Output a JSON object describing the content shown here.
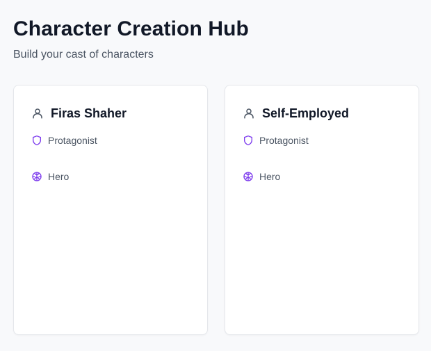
{
  "header": {
    "title": "Character Creation Hub",
    "subtitle": "Build your cast of characters"
  },
  "cards": [
    {
      "name": "Firas Shaher",
      "role": "Protagonist",
      "trait": "Hero",
      "icons": {
        "name": "user-icon",
        "role": "shield-icon",
        "trait": "brain-icon"
      }
    },
    {
      "name": "Self-Employed",
      "role": "Protagonist",
      "trait": "Hero",
      "icons": {
        "name": "user-icon",
        "role": "shield-icon",
        "trait": "brain-icon"
      }
    }
  ],
  "colors": {
    "background": "#f8f9fb",
    "card_border": "#e5e7eb",
    "title": "#111827",
    "muted_text": "#4b5563",
    "user_icon": "#4b5563",
    "accent_icon": "#7c3aed"
  }
}
